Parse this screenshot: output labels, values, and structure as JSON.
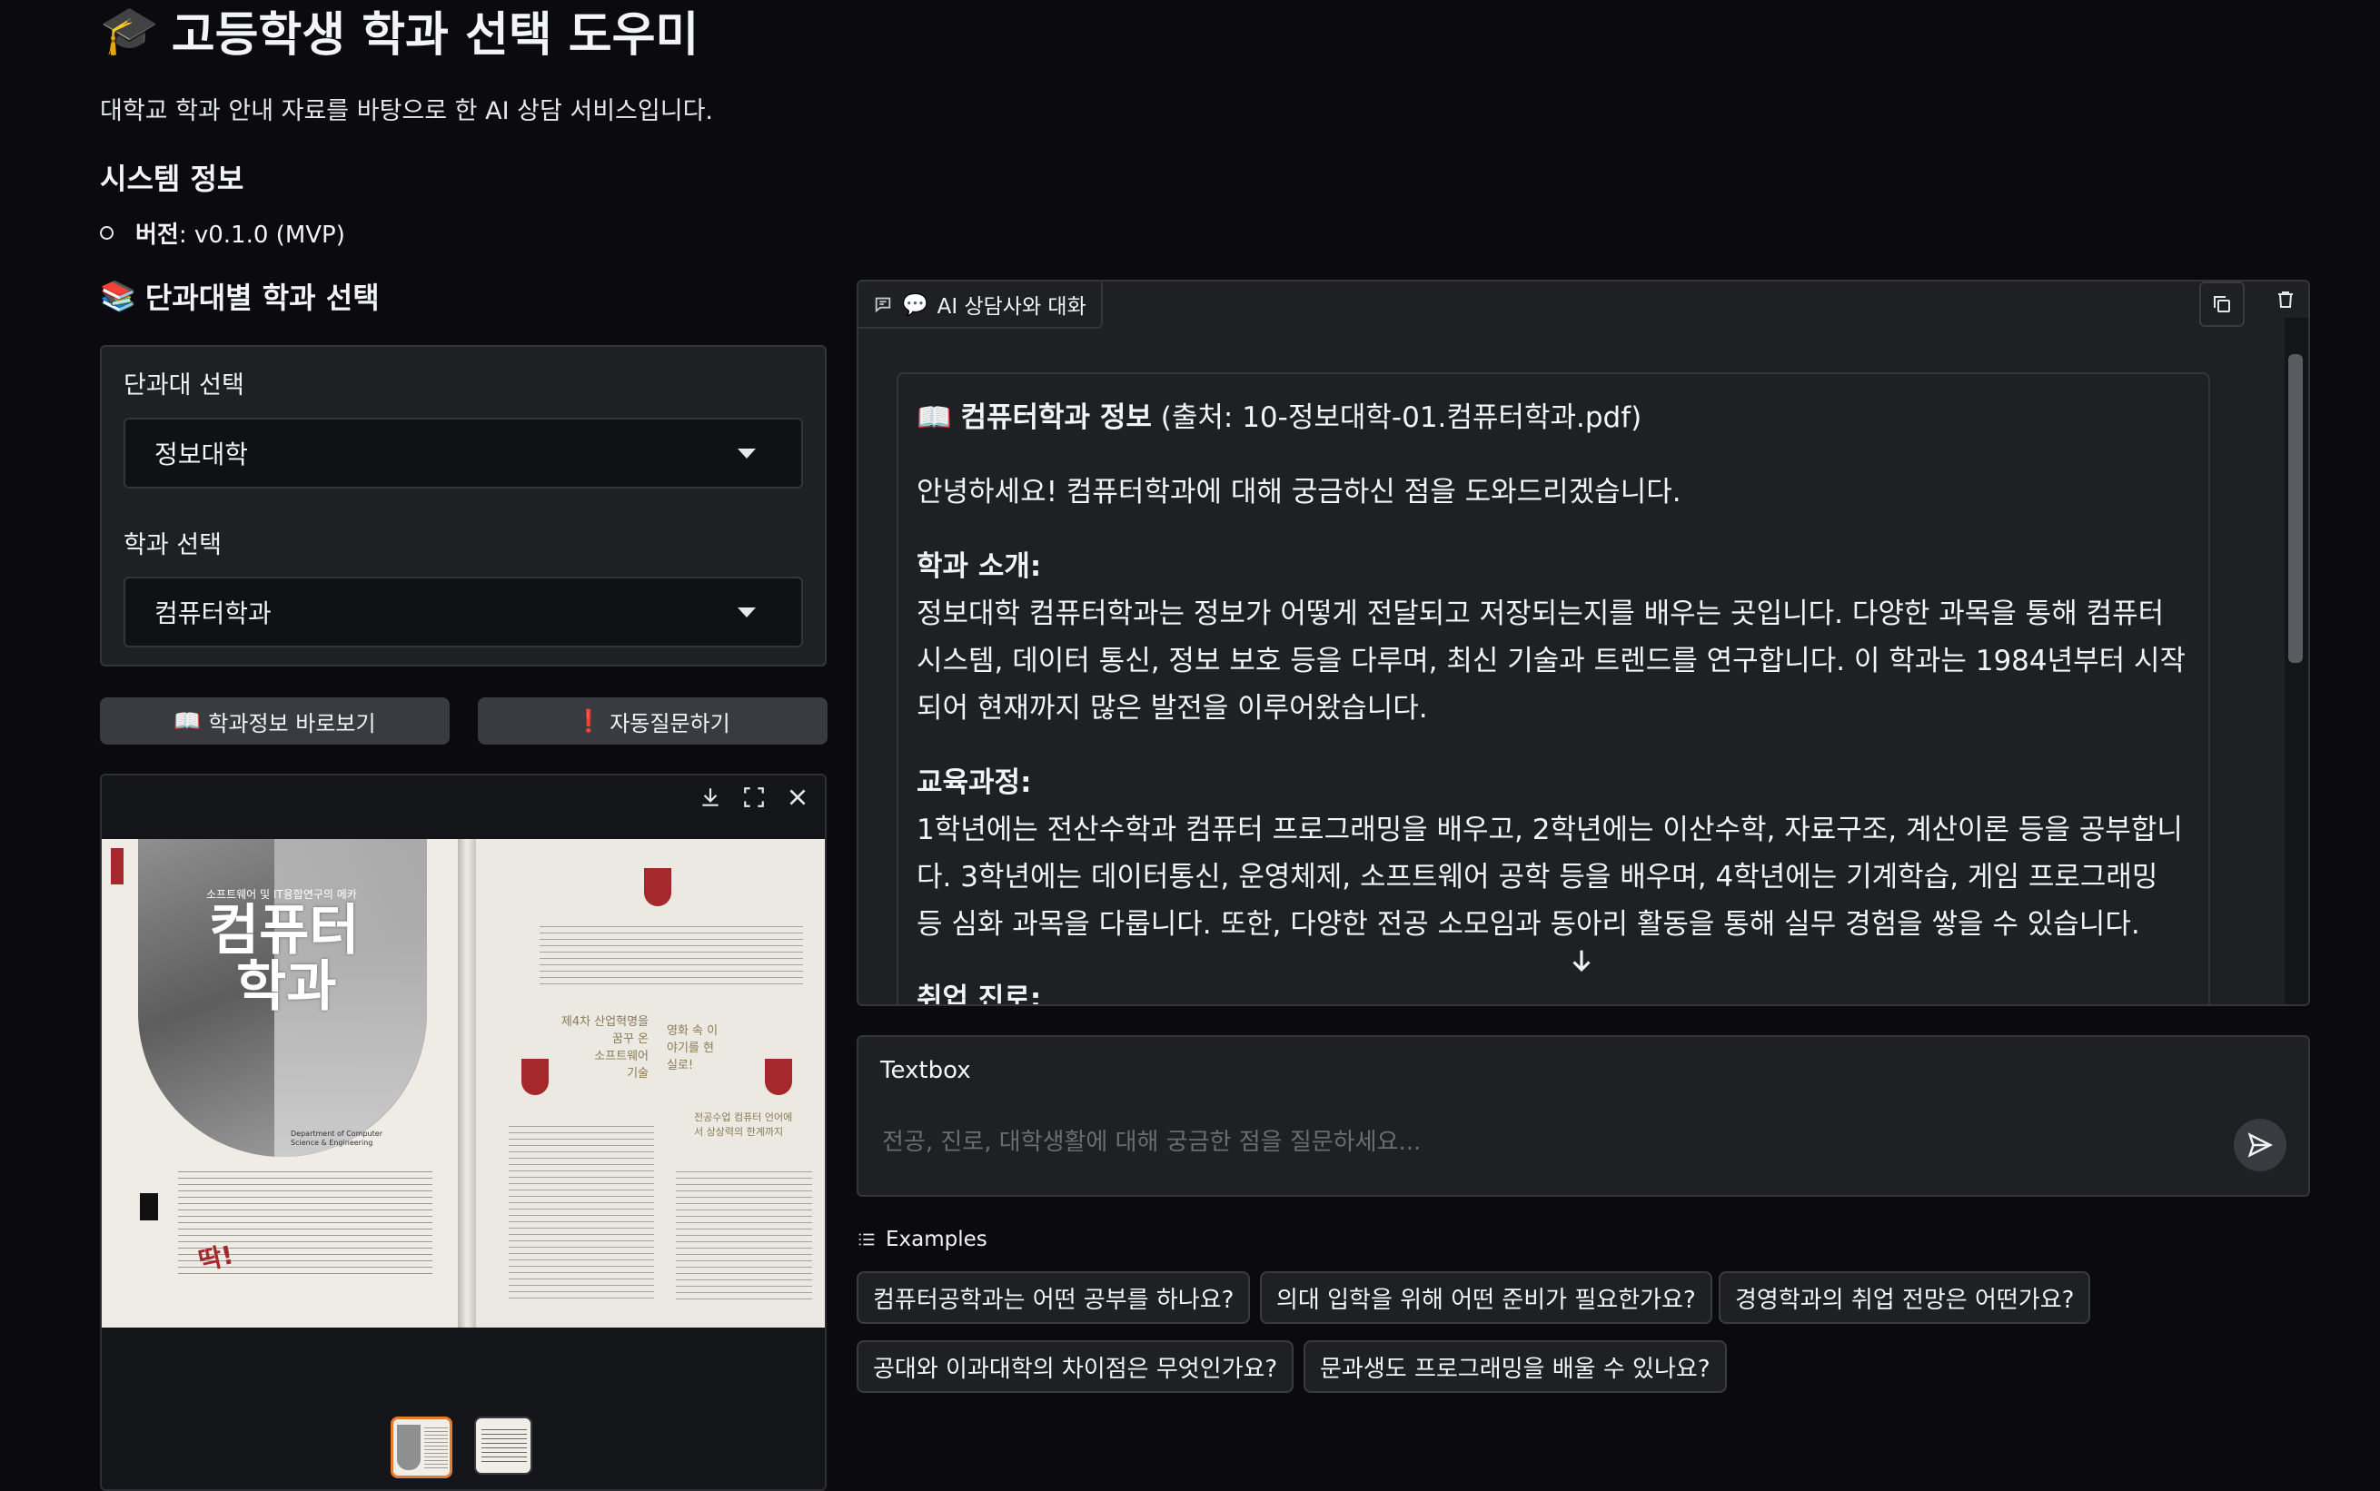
{
  "page": {
    "title_icon": "🎓",
    "title": "고등학생 학과 선택 도우미",
    "subtitle": "대학교 학과 안내 자료를 바탕으로 한 AI 상담 서비스입니다."
  },
  "system": {
    "heading": "시스템 정보",
    "version_label": "버전",
    "version_value": ": v0.1.0 (MVP)"
  },
  "selection": {
    "heading_icon": "📚",
    "heading": "단과대별 학과 선택",
    "college_label": "단과대 선택",
    "college_value": "정보대학",
    "dept_label": "학과 선택",
    "dept_value": "컴퓨터학과"
  },
  "buttons": {
    "view_info_icon": "📖",
    "view_info": "학과정보 바로보기",
    "auto_question_icon": "❗",
    "auto_question": "자동질문하기"
  },
  "gallery": {
    "brochure_tagline": "소프트웨어 및 IT융합연구의 메카",
    "brochure_title_1": "컴퓨터",
    "brochure_title_2": "학과",
    "brochure_sub": "Department of Computer Science & Engineering",
    "brochure_quote_1": "제4차 산업혁명을 \n 꿈꾸 온 \n 소프트웨어 \n 기술",
    "brochure_quote_2": "영화 속 이야기를 현실로!",
    "brochure_quote_3": "전공수업 컴퓨터 언어에서 상상력의 한계까지",
    "brochure_stamp": "딱!",
    "thumbnails": [
      "page-1",
      "page-2"
    ]
  },
  "chat": {
    "tab_icon": "💬",
    "tab_label": "AI 상담사와 대화",
    "message": {
      "head_icon": "📖",
      "head_bold": "컴퓨터학과 정보",
      "head_rest": " (출처: 10-정보대학-01.컴퓨터학과.pdf)",
      "greeting": "안녕하세요! 컴퓨터학과에 대해 궁금하신 점을 도와드리겠습니다.",
      "intro_h": "학과 소개:",
      "intro_body": "정보대학 컴퓨터학과는 정보가 어떻게 전달되고 저장되는지를 배우는 곳입니다. 다양한 과목을 통해 컴퓨터 시스템, 데이터 통신, 정보 보호 등을 다루며, 최신 기술과 트렌드를 연구합니다. 이 학과는 1984년부터 시작되어 현재까지 많은 발전을 이루어왔습니다.",
      "curriculum_h": "교육과정:",
      "curriculum_body": "1학년에는 전산수학과 컴퓨터 프로그래밍을 배우고, 2학년에는 이산수학, 자료구조, 계산이론 등을 공부합니다. 3학년에는 데이터통신, 운영체제, 소프트웨어 공학 등을 배우며, 4학년에는 기계학습, 게임 프로그래밍 등 심화 과목을 다룹니다. 또한, 다양한 전공 소모임과 동아리 활동을 통해 실무 경험을 쌓을 수 있습니다.",
      "career_h": "취업 진로:"
    }
  },
  "input": {
    "label": "Textbox",
    "placeholder": "전공, 진로, 대학생활에 대해 궁금한 점을 질문하세요..."
  },
  "examples": {
    "heading": "Examples",
    "items": [
      "컴퓨터공학과는 어떤 공부를 하나요?",
      "의대 입학을 위해 어떤 준비가 필요한가요?",
      "경영학과의 취업 전망은 어떤가요?",
      "공대와 이과대학의 차이점은 무엇인가요?",
      "문과생도 프로그래밍을 배울 수 있나요?"
    ]
  },
  "colors": {
    "background": "#0b0b0f",
    "panel": "#1f2023",
    "accent_button": "#3a3b40",
    "brochure_red": "#a5282c"
  }
}
